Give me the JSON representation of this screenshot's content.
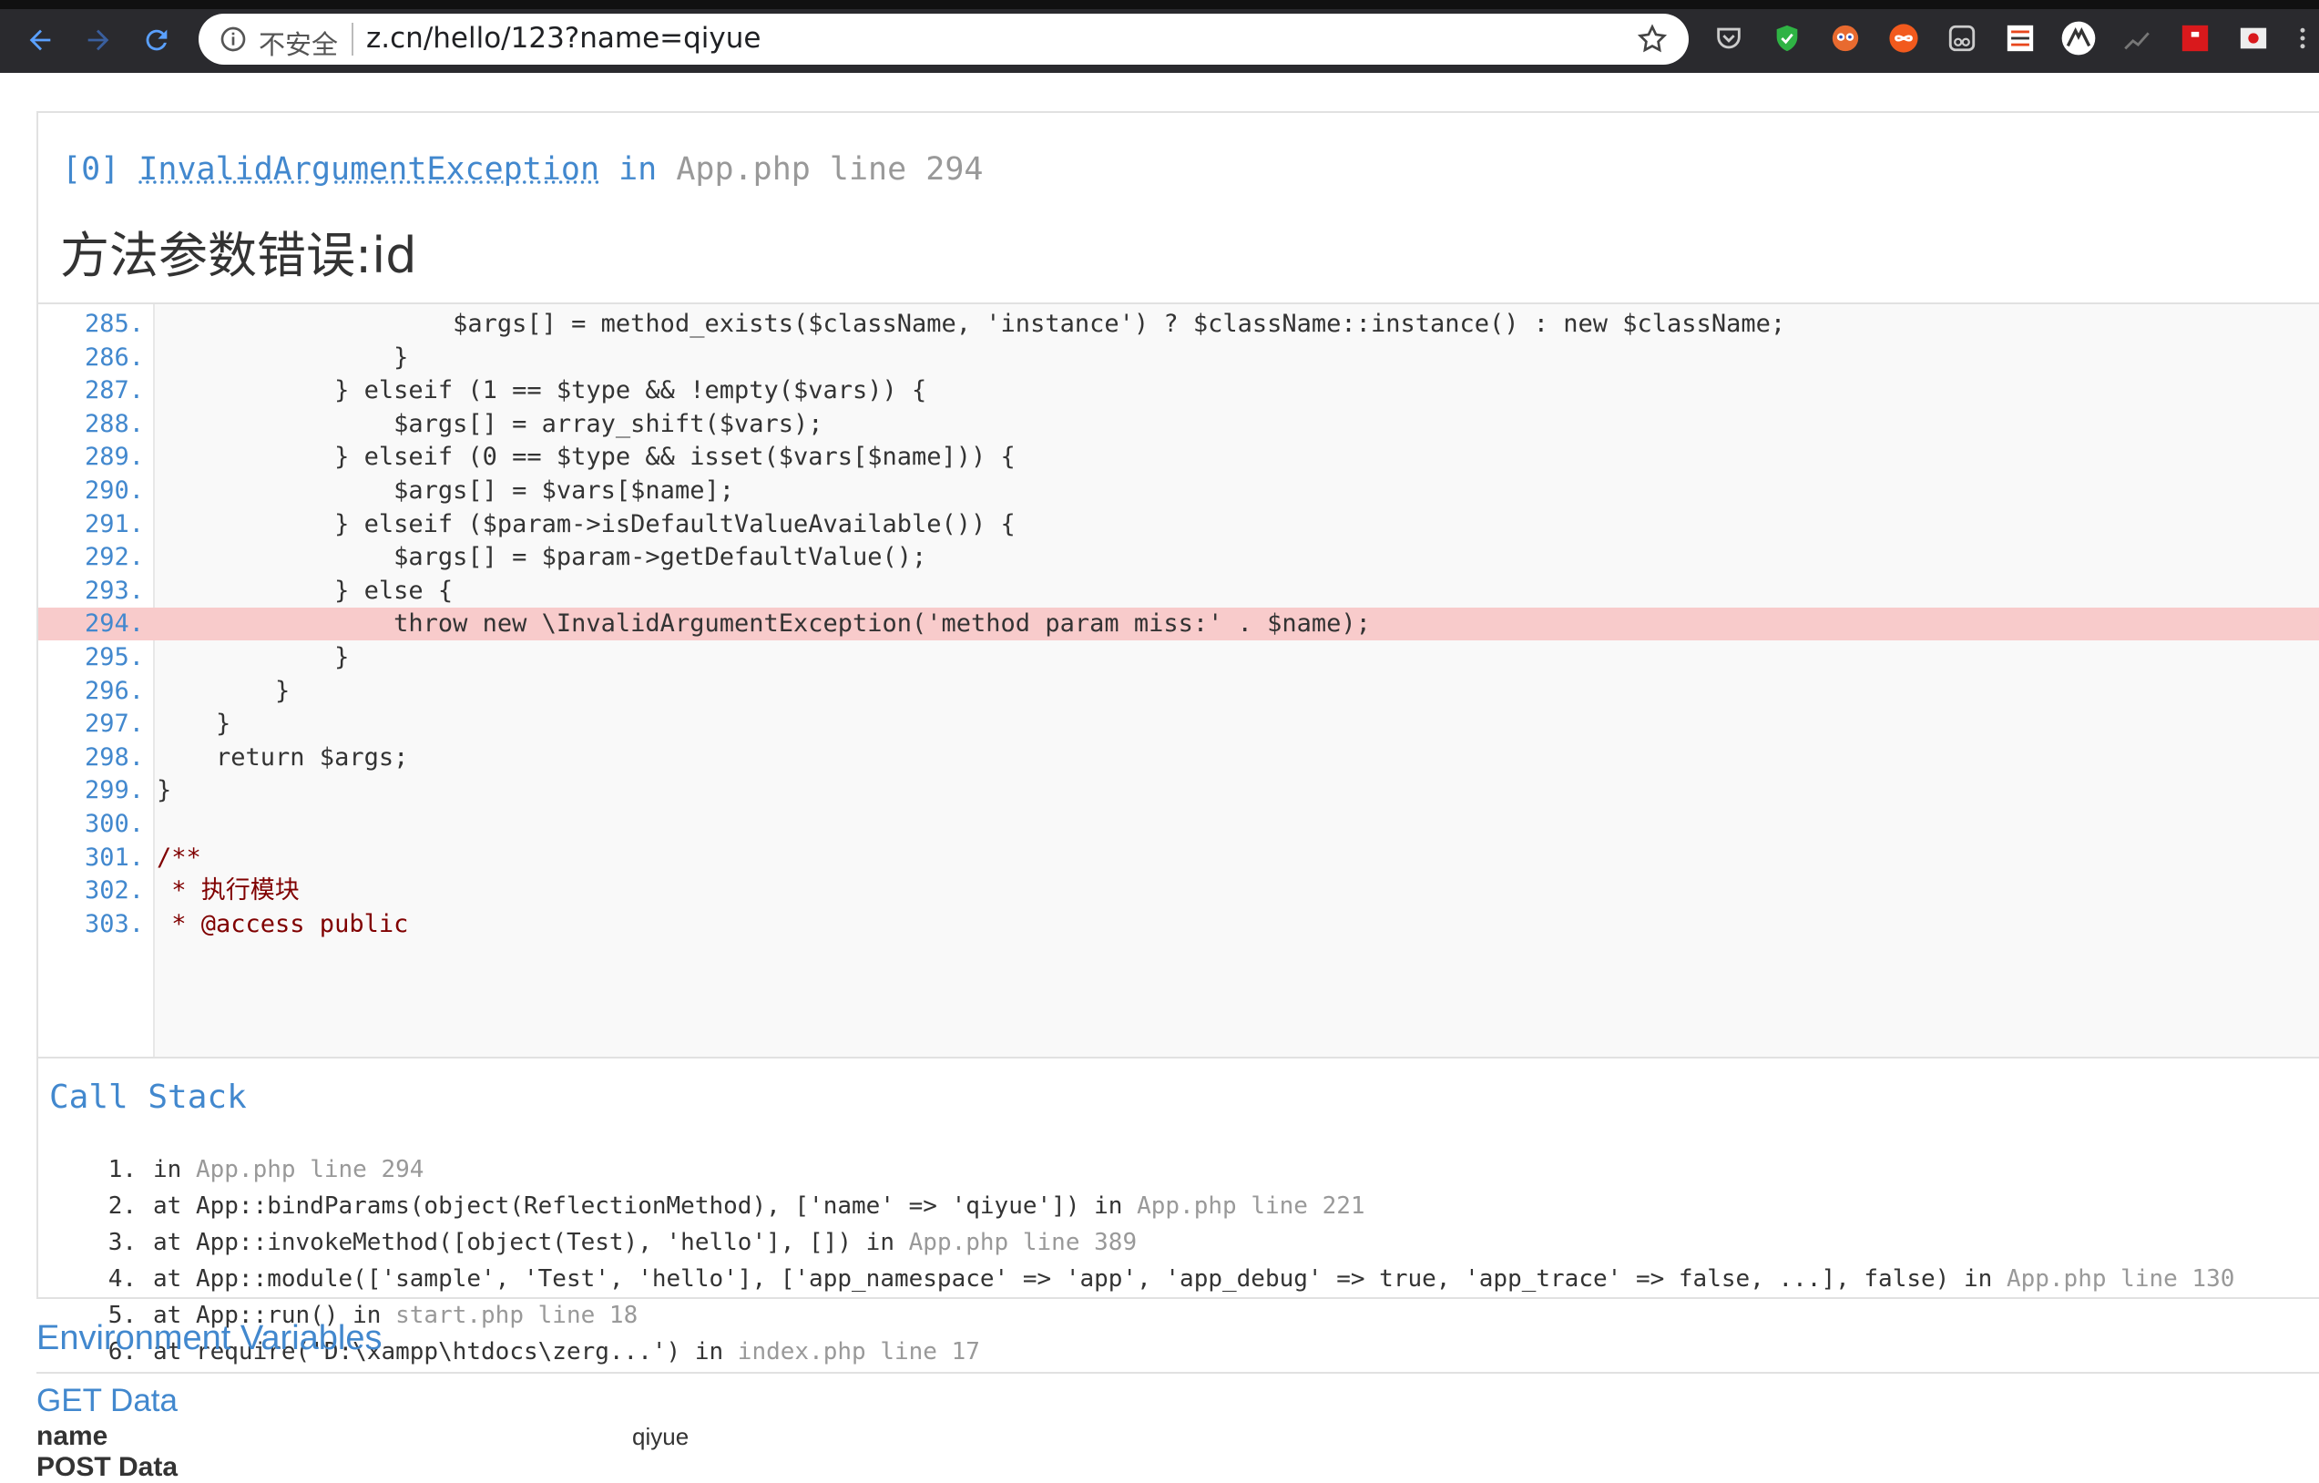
{
  "browser": {
    "insecure_label": "不安全",
    "url": "z.cn/hello/123?name=qiyue"
  },
  "exception": {
    "index": "[0]",
    "class": "InvalidArgumentException",
    "in_word": "in",
    "location": "App.php line 294",
    "message": "方法参数错误:id"
  },
  "source_lines": [
    {
      "num": "285.",
      "text": "                    $args[] = method_exists($className, 'instance') ? $className::instance() : new $className;"
    },
    {
      "num": "286.",
      "text": "                }"
    },
    {
      "num": "287.",
      "text": "            } elseif (1 == $type && !empty($vars)) {"
    },
    {
      "num": "288.",
      "text": "                $args[] = array_shift($vars);"
    },
    {
      "num": "289.",
      "text": "            } elseif (0 == $type && isset($vars[$name])) {"
    },
    {
      "num": "290.",
      "text": "                $args[] = $vars[$name];"
    },
    {
      "num": "291.",
      "text": "            } elseif ($param->isDefaultValueAvailable()) {"
    },
    {
      "num": "292.",
      "text": "                $args[] = $param->getDefaultValue();"
    },
    {
      "num": "293.",
      "text": "            } else {"
    },
    {
      "num": "294.",
      "text": "                throw new \\InvalidArgumentException('method param miss:' . $name);"
    },
    {
      "num": "295.",
      "text": "            }"
    },
    {
      "num": "296.",
      "text": "        }"
    },
    {
      "num": "297.",
      "text": "    }"
    },
    {
      "num": "298.",
      "text": "    return $args;"
    },
    {
      "num": "299.",
      "text": "}"
    },
    {
      "num": "300.",
      "text": ""
    },
    {
      "num": "301.",
      "text": "/**"
    },
    {
      "num": "302.",
      "text": " * 执行模块"
    },
    {
      "num": "303.",
      "text": " * @access public"
    }
  ],
  "call_stack": {
    "title": "Call Stack",
    "items": [
      {
        "num": "1.",
        "text": "in ",
        "loc": "App.php line 294"
      },
      {
        "num": "2.",
        "text": "at App::bindParams(object(ReflectionMethod), ['name' => 'qiyue']) in ",
        "loc": "App.php line 221"
      },
      {
        "num": "3.",
        "text": "at App::invokeMethod([object(Test), 'hello'], []) in ",
        "loc": "App.php line 389"
      },
      {
        "num": "4.",
        "text": "at App::module(['sample', 'Test', 'hello'], ['app_namespace' => 'app', 'app_debug' => true, 'app_trace' => false, ...], false) in ",
        "loc": "App.php line 130"
      },
      {
        "num": "5.",
        "text": "at App::run() in ",
        "loc": "start.php line 18"
      },
      {
        "num": "6.",
        "text": "at require('D:\\xampp\\htdocs\\zerg...') in ",
        "loc": "index.php line 17"
      }
    ]
  },
  "env": {
    "title": "Environment Variables",
    "get_title": "GET Data",
    "get_key": "name",
    "get_value": "qiyue",
    "post_title": "POST Data"
  }
}
